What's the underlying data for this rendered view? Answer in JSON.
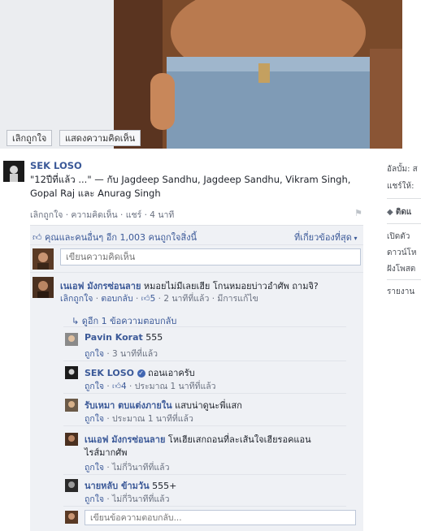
{
  "photo": {
    "unlike_label": "เลิกถูกใจ",
    "comment_label": "แสดงความคิดเห็น"
  },
  "right_col": {
    "line1": "อัลบั้ม: ส",
    "line2": "แชร์ให้:",
    "line3": "ติดแ",
    "line4": "เปิดตัว",
    "line5": "ดาวน์โห",
    "line6": "ฝังโพสต",
    "line7": "รายงาน"
  },
  "post": {
    "author": "SEK LOSO",
    "text_line1": "\"12ปีที่แล้ว ...\" — กับ Jagdeep Sandhu, Jagdeep Sandhu, Vikram Singh,",
    "text_line2": "Gopal Raj และ Anurag Singh",
    "unlike": "เลิกถูกใจ",
    "comment": "ความคิดเห็น",
    "share": "แชร์",
    "time": "4 นาที",
    "sep": "·"
  },
  "likes": {
    "text": "คุณและคนอื่นๆ อีก 1,003 คนถูกใจสิ่งนี้",
    "sort": "ที่เกี่ยวข้องที่สุด"
  },
  "comment_input": {
    "placeholder": "เขียนความคิดเห็น"
  },
  "comments": [
    {
      "name": "เนเอฟ มังกรซ่อนลาย",
      "text": "หมอยไม่มีเลยเฮีย โกนหมอยบ่าวอำศัพ ถามจิ?",
      "like": "เลิกถูกใจ",
      "reply": "ตอบกลับ",
      "likes": "5",
      "time": "2 นาทีที่แล้ว",
      "edited": "มีการแก้ไข"
    }
  ],
  "view_more": "ดูอีก 1 ข้อความตอบกลับ",
  "replies": [
    {
      "name": "Pavin Korat",
      "text": "555",
      "like": "ถูกใจ",
      "time": "3 นาทีที่แล้ว"
    },
    {
      "name": "SEK LOSO",
      "text": "ถอนเอาครับ",
      "like": "ถูกใจ",
      "likes": "4",
      "time": "ประมาณ 1 นาทีที่แล้ว"
    },
    {
      "name": "รับเหมา ตบแต่งภายใน",
      "text": "แสบน่าดูนะพี่แสก",
      "like": "ถูกใจ",
      "time": "ประมาณ 1 นาทีที่แล้ว"
    },
    {
      "name": "เนเอฟ มังกรซ่อนลาย",
      "text": "โหเฮียเสกถอนที่ละเส้นใจเฮียรอคแอน",
      "text2": "ไรส์มากศัพ",
      "like": "ถูกใจ",
      "time": "ไม่กี่วินาทีที่แล้ว"
    },
    {
      "name": "นายหลับ ข้ามวัน",
      "text": "555+",
      "like": "ถูกใจ",
      "time": "ไม่กี่วินาทีที่แล้ว"
    }
  ],
  "reply_input": {
    "placeholder": "เขียนข้อความตอบกลับ..."
  },
  "colors": {
    "link": "#3b5998",
    "meta": "#6a7180",
    "box": "#eff1f5",
    "verified": "#4267b2"
  }
}
